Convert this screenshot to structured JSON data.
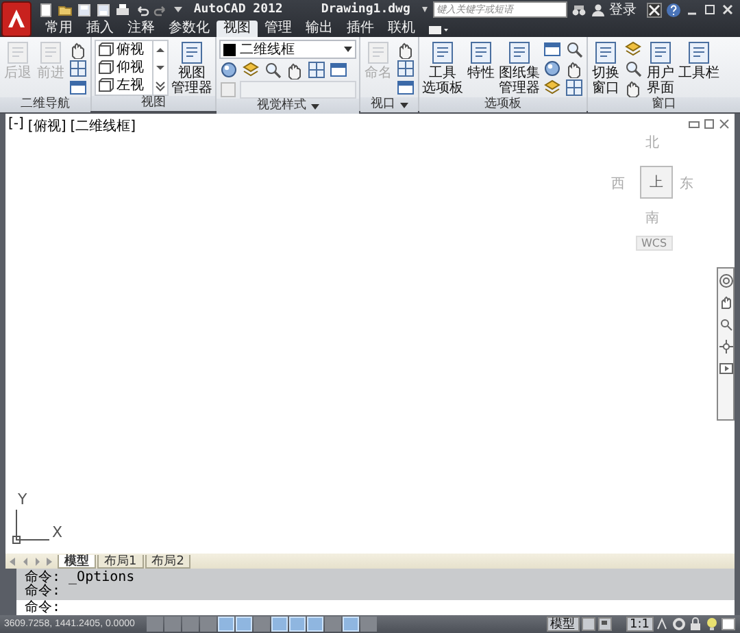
{
  "title_bar": {
    "title": "AutoCAD 2012",
    "document": "Drawing1.dwg",
    "search": {
      "placeholder": "键入关键字或短语"
    },
    "sign_in": "登录"
  },
  "tabs": [
    {
      "label": "常用",
      "selected": false
    },
    {
      "label": "插入",
      "selected": false
    },
    {
      "label": "注释",
      "selected": false
    },
    {
      "label": "参数化",
      "selected": false
    },
    {
      "label": "视图",
      "selected": true
    },
    {
      "label": "管理",
      "selected": false
    },
    {
      "label": "输出",
      "selected": false
    },
    {
      "label": "插件",
      "selected": false
    },
    {
      "label": "联机",
      "selected": false
    }
  ],
  "ribbon_panels": [
    {
      "title": "二维导航",
      "menu": false,
      "items": [
        {
          "kind": "large",
          "label": [
            "后退"
          ],
          "disabled": true
        },
        {
          "kind": "large",
          "label": [
            "前进"
          ],
          "disabled": true
        },
        {
          "kind": "icons"
        }
      ]
    },
    {
      "title": "视图",
      "menu": false,
      "items": [
        {
          "kind": "list",
          "entries": [
            "俯视",
            "仰视",
            "左视"
          ]
        },
        {
          "kind": "large",
          "label": [
            "视图",
            "管理器"
          ],
          "disabled": false
        }
      ]
    },
    {
      "title": "视觉样式",
      "menu": true,
      "items": [
        {
          "kind": "style",
          "value": "二维线框"
        }
      ]
    },
    {
      "title": "视口",
      "menu": true,
      "items": [
        {
          "kind": "large",
          "label": [
            "命名"
          ],
          "disabled": true
        },
        {
          "kind": "icons"
        }
      ]
    },
    {
      "title": "选项板",
      "menu": false,
      "items": [
        {
          "kind": "large",
          "label": [
            "工具",
            "选项板"
          ],
          "disabled": false
        },
        {
          "kind": "large",
          "label": [
            "特性"
          ],
          "disabled": false
        },
        {
          "kind": "large",
          "label": [
            "图纸集",
            "管理器"
          ],
          "disabled": false
        },
        {
          "kind": "icons"
        },
        {
          "kind": "icons"
        }
      ]
    },
    {
      "title": "窗口",
      "menu": false,
      "items": [
        {
          "kind": "large",
          "label": [
            "切换",
            "窗口"
          ],
          "disabled": false
        },
        {
          "kind": "icons"
        },
        {
          "kind": "large",
          "label": [
            "用户",
            "界面"
          ],
          "disabled": false
        },
        {
          "kind": "large",
          "label": [
            "工具栏"
          ],
          "disabled": false
        }
      ]
    }
  ],
  "viewport": {
    "labels": [
      "[-]",
      "[俯视]",
      "[二维线框]"
    ],
    "viewcube": {
      "north": "北",
      "east": "东",
      "south": "南",
      "west": "西",
      "face": "上",
      "ucs": "WCS"
    },
    "ucs_icon": {
      "x": "X",
      "y": "Y"
    }
  },
  "layout_tabs": [
    {
      "label": "模型",
      "selected": true
    },
    {
      "label": "布局1",
      "selected": false
    },
    {
      "label": "布局2",
      "selected": false
    }
  ],
  "command": {
    "history": [
      "命令: _Options",
      "命令:"
    ],
    "prompt": "命令:"
  },
  "status_bar": {
    "coordinates": "3609.7258, 1441.2405, 0.0000",
    "toggles": [
      {
        "on": false
      },
      {
        "on": false
      },
      {
        "on": false
      },
      {
        "on": false
      },
      {
        "on": true
      },
      {
        "on": true
      },
      {
        "on": false
      },
      {
        "on": true
      },
      {
        "on": true
      },
      {
        "on": true
      },
      {
        "on": false
      },
      {
        "on": true
      },
      {
        "on": false
      }
    ],
    "space": "模型",
    "scale": "1:1"
  }
}
